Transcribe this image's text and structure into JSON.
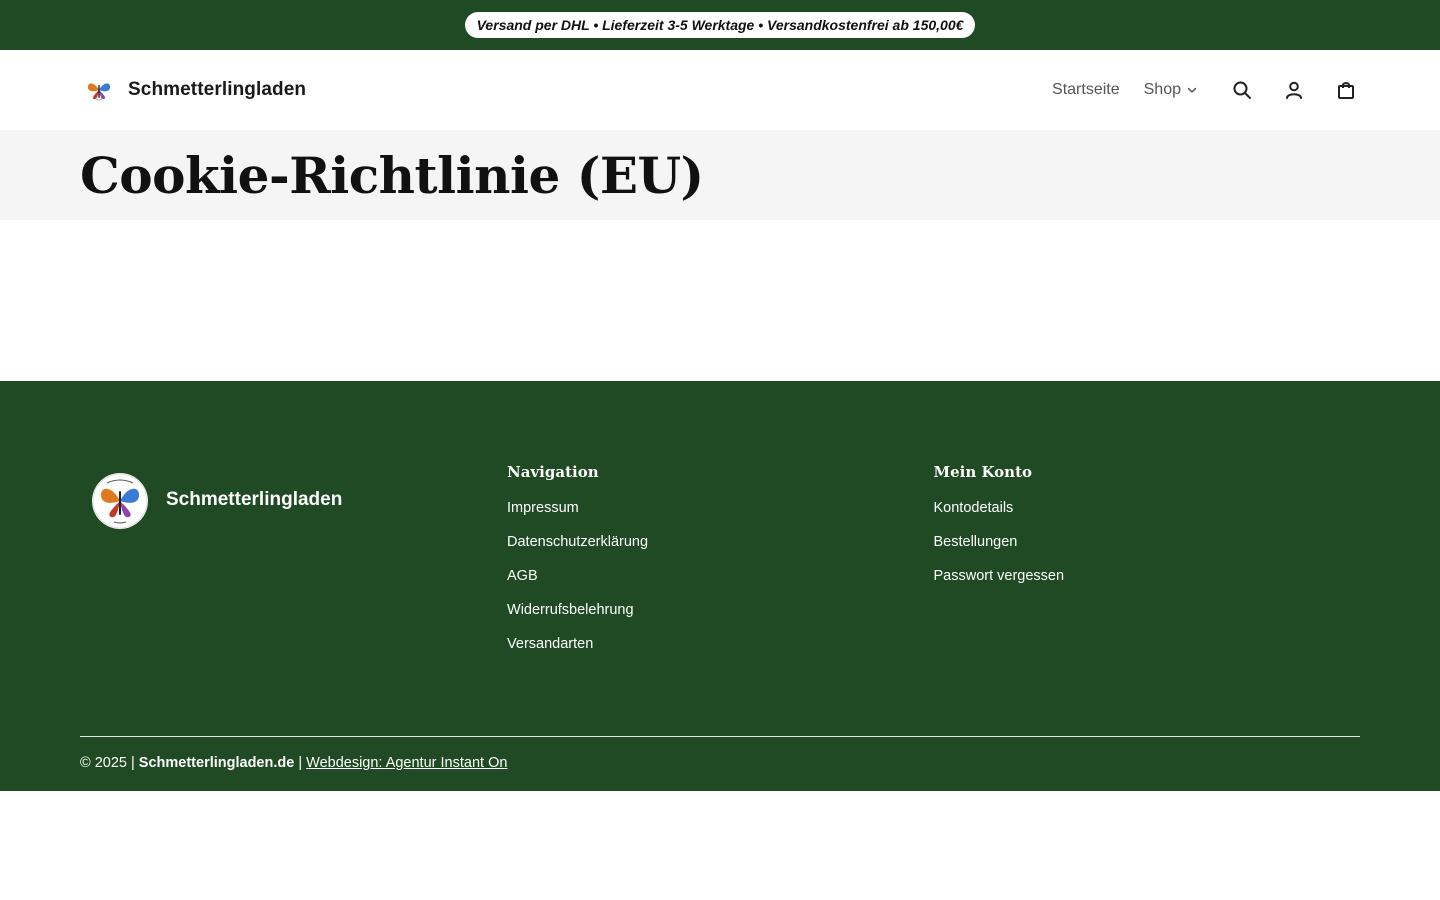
{
  "topbar": {
    "announcement": "Versand per DHL • Lieferzeit 3-5 Werktage • Versandkostenfrei ab 150,00€"
  },
  "header": {
    "brand_name": "Schmetterlingladen",
    "nav": {
      "home": "Startseite",
      "shop": "Shop"
    },
    "icons": [
      "search-icon",
      "account-icon",
      "cart-icon"
    ]
  },
  "page": {
    "title": "Cookie-Richtlinie (EU)"
  },
  "footer": {
    "brand_name": "Schmetterlingladen",
    "columns": [
      {
        "heading": "Navigation",
        "links": [
          "Impressum",
          "Datenschutzerklärung",
          "AGB",
          "Widerrufsbelehrung",
          "Versandarten"
        ]
      },
      {
        "heading": "Mein Konto",
        "links": [
          "Kontodetails",
          "Bestellungen",
          "Passwort vergessen"
        ]
      }
    ],
    "copyright": "© 2025 |",
    "site": "Schmetterlingladen.de",
    "separator": "|",
    "credit": "Webdesign: Agentur Instant On"
  },
  "colors": {
    "brand_green": "#204a23",
    "title_band": "#f5f5f5"
  }
}
